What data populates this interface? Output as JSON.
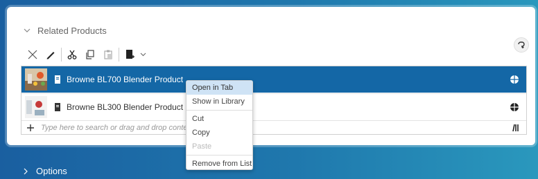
{
  "section": {
    "title": "Related Products"
  },
  "toolbar": {
    "icons": [
      "close-icon",
      "edit-icon",
      "cut-icon",
      "copy-icon",
      "paste-icon",
      "create-document-icon",
      "chevron-down-icon"
    ]
  },
  "list": {
    "rows": [
      {
        "label": "Browne BL700 Blender Product",
        "selected": true
      },
      {
        "label": "Browne BL300 Blender Product",
        "selected": false
      }
    ],
    "search_placeholder": "Type here to search or drag and drop content onto"
  },
  "context_menu": {
    "items": [
      "Open in Tab",
      "Show in Library",
      "Cut",
      "Copy",
      "Paste",
      "Remove from List"
    ],
    "highlighted": "Open in Tab",
    "disabled": [
      "Paste"
    ]
  },
  "options": {
    "title": "Options"
  },
  "colors": {
    "accent": "#1467a6",
    "highlight": "#cfe3f5",
    "background": "#1f78ad"
  }
}
